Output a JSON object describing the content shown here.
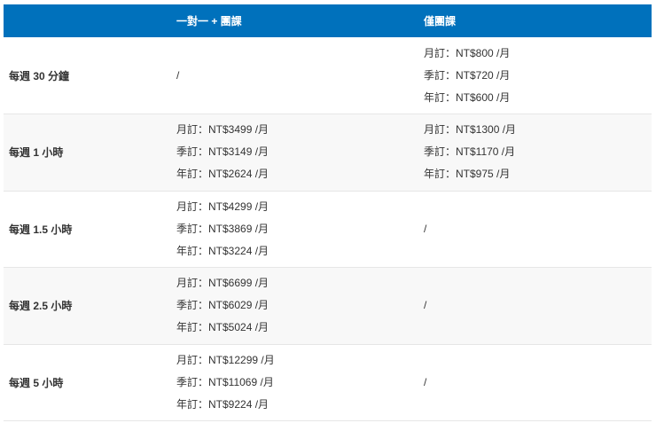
{
  "header": {
    "col1": "",
    "col2": "一對一 + 團課",
    "col3": "僅團課"
  },
  "rows": [
    {
      "label": "每週 30 分鐘",
      "combo": [
        "/"
      ],
      "group": [
        "月訂：NT$800 /月",
        "季訂：NT$720 /月",
        "年訂：NT$600 /月"
      ]
    },
    {
      "label": "每週 1 小時",
      "combo": [
        "月訂：NT$3499 /月",
        "季訂：NT$3149 /月",
        "年訂：NT$2624 /月"
      ],
      "group": [
        "月訂：NT$1300 /月",
        "季訂：NT$1170 /月",
        "年訂：NT$975 /月"
      ]
    },
    {
      "label": "每週 1.5 小時",
      "combo": [
        "月訂：NT$4299 /月",
        "季訂：NT$3869 /月",
        "年訂：NT$3224 /月"
      ],
      "group": [
        "/"
      ]
    },
    {
      "label": "每週 2.5 小時",
      "combo": [
        "月訂：NT$6699 /月",
        "季訂：NT$6029 /月",
        "年訂：NT$5024 /月"
      ],
      "group": [
        "/"
      ]
    },
    {
      "label": "每週 5 小時",
      "combo": [
        "月訂：NT$12299 /月",
        "季訂：NT$11069 /月",
        "年訂：NT$9224 /月"
      ],
      "group": [
        "/"
      ]
    }
  ]
}
